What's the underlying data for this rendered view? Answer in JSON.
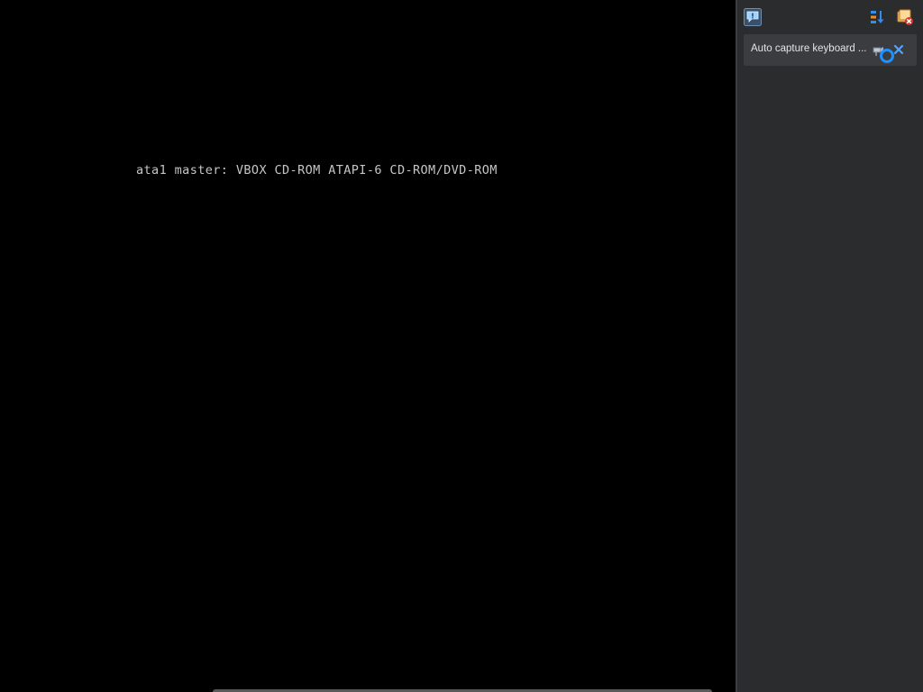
{
  "vm": {
    "console_line": "ata1 master: VBOX CD-ROM ATAPI-6 CD-ROM/DVD-ROM"
  },
  "side_panel": {
    "toolbar": {
      "messages_icon": "speech-bubble-info-icon",
      "sort_icon": "sort-order-icon",
      "clear_icon": "clear-all-icon"
    },
    "notifications": [
      {
        "text": "Auto capture keyboard ...",
        "pin_icon": "pin-icon",
        "close_icon": "close-icon"
      }
    ]
  },
  "colors": {
    "console_text": "#c6c6c6",
    "panel_bg": "#2b2c2e",
    "notification_bg": "#3b3c3f",
    "accent_blue": "#1e90ff"
  }
}
